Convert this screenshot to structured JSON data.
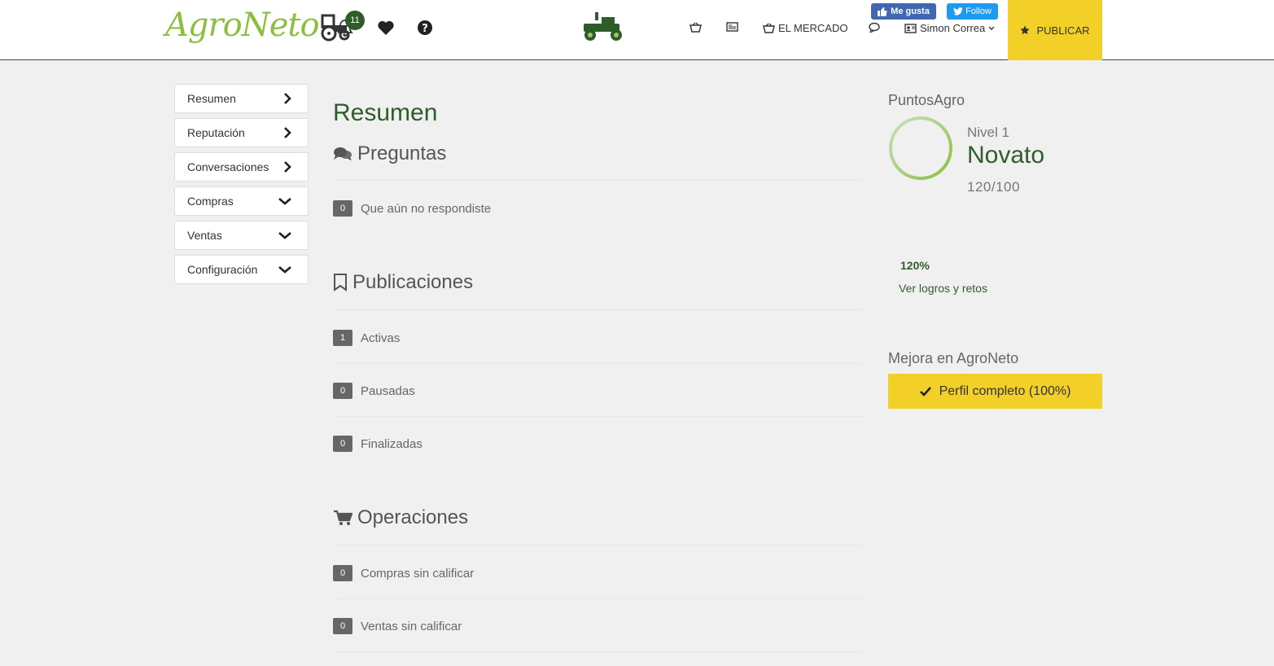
{
  "header": {
    "logo_text": "AgroNeto",
    "notifications_count": "11",
    "nav": {
      "mercado_label": "EL MERCADO",
      "user_name": "Simon Correa",
      "publicar_label": "PUBLICAR"
    },
    "social": {
      "facebook_label": "Me gusta",
      "twitter_label": "Follow"
    }
  },
  "sidebar": {
    "items": [
      {
        "label": "Resumen",
        "chevron": "right"
      },
      {
        "label": "Reputación",
        "chevron": "right"
      },
      {
        "label": "Conversaciones",
        "chevron": "right"
      },
      {
        "label": "Compras",
        "chevron": "down"
      },
      {
        "label": "Ventas",
        "chevron": "down"
      },
      {
        "label": "Configuración",
        "chevron": "down"
      }
    ]
  },
  "main": {
    "title": "Resumen",
    "preguntas": {
      "title": "Preguntas",
      "rows": [
        {
          "count": "0",
          "label": "Que aún no respondiste"
        }
      ]
    },
    "publicaciones": {
      "title": "Publicaciones",
      "rows": [
        {
          "count": "1",
          "label": "Activas"
        },
        {
          "count": "0",
          "label": "Pausadas"
        },
        {
          "count": "0",
          "label": "Finalizadas"
        }
      ]
    },
    "operaciones": {
      "title": "Operaciones",
      "rows": [
        {
          "count": "0",
          "label": "Compras sin calificar"
        },
        {
          "count": "0",
          "label": "Ventas sin calificar"
        }
      ]
    }
  },
  "right": {
    "puntos_title": "PuntosAgro",
    "nivel": "Nivel 1",
    "rank": "Novato",
    "points": "120/100",
    "percent": "120%",
    "logros_link": "Ver logros y retos",
    "mejora_title": "Mejora en AgroNeto",
    "perfil_button": "Perfil completo (100%)"
  },
  "colors": {
    "brand_green": "#2f5d2a",
    "logo_green": "#8cbf3f",
    "accent_yellow": "#f2d027"
  }
}
